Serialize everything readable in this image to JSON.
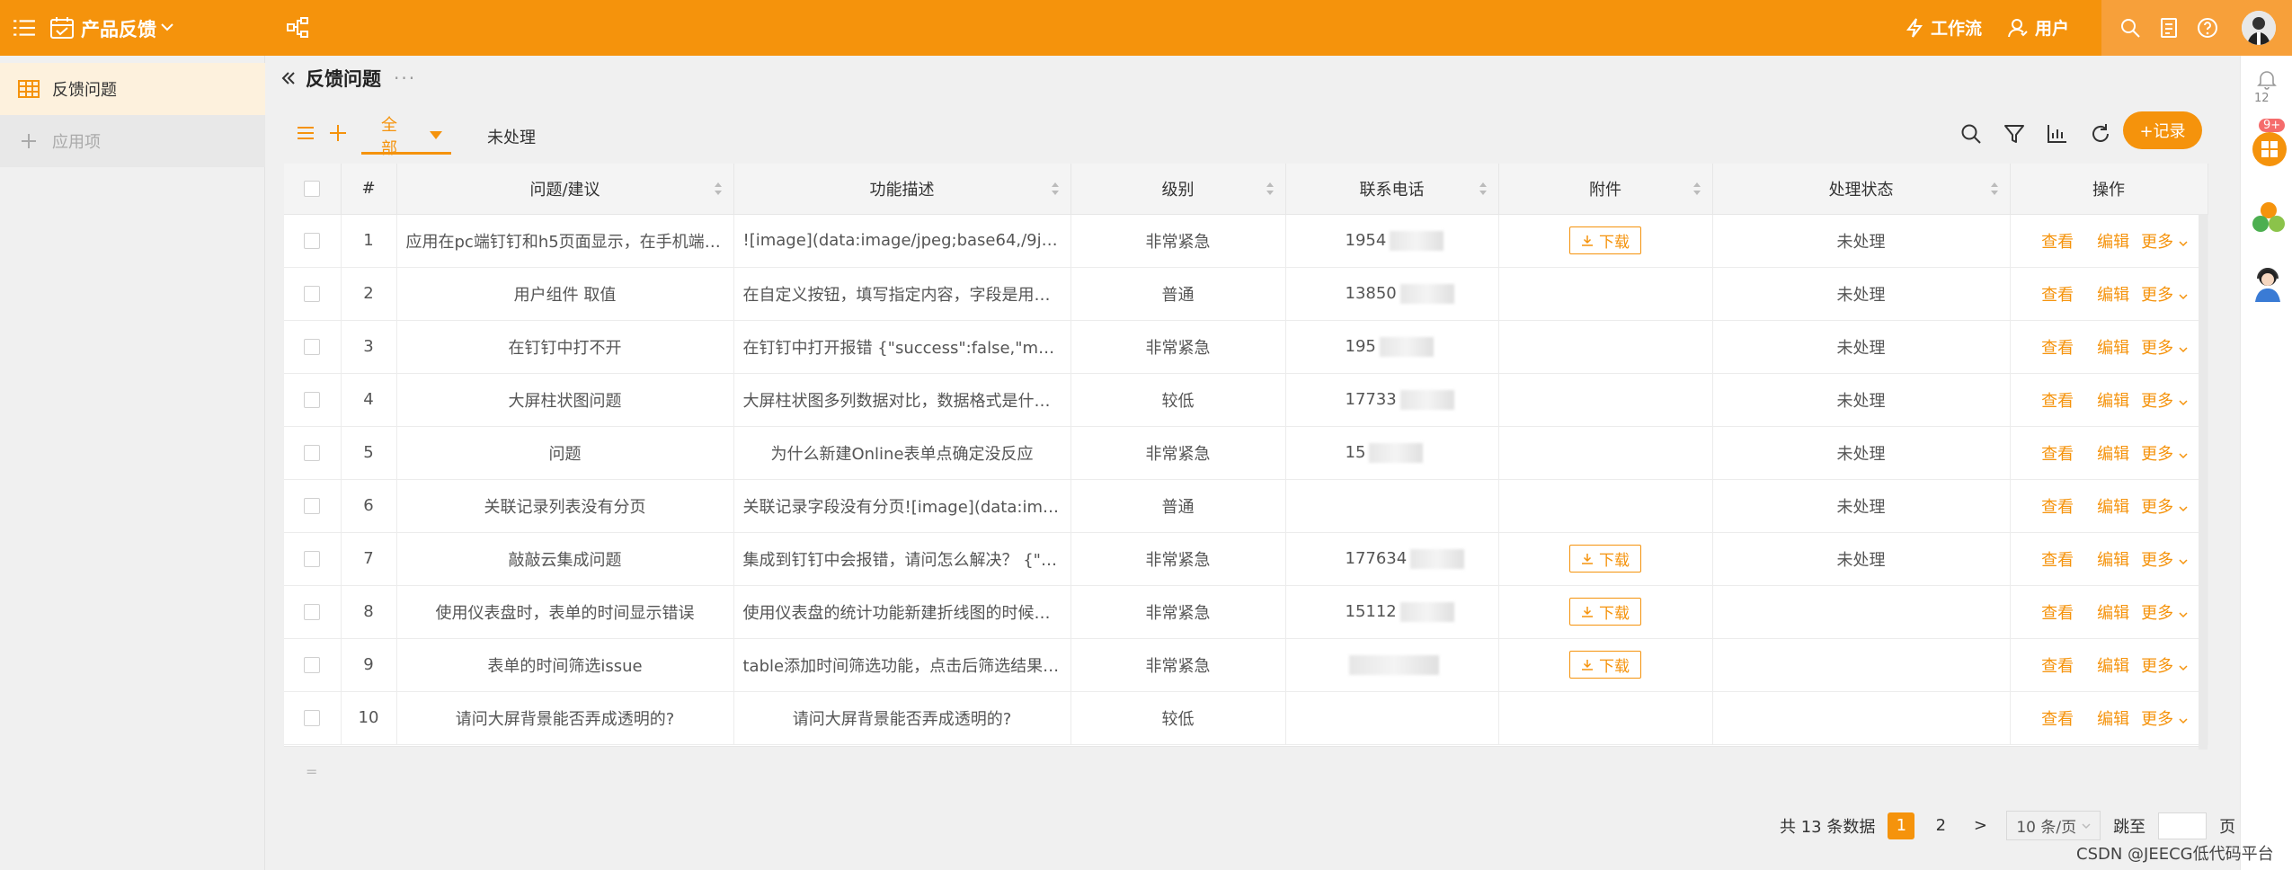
{
  "topbar": {
    "app_title": "产品反馈",
    "link_workflow": "工作流",
    "link_user": "用户"
  },
  "sidebar": {
    "items": [
      {
        "label": "反馈问题"
      },
      {
        "label": "应用项"
      }
    ]
  },
  "page": {
    "title": "反馈问题",
    "more": "···"
  },
  "toolbar": {
    "tab_all": "全部",
    "tab_unprocessed": "未处理",
    "add_label": "+记录"
  },
  "table": {
    "columns": [
      "#",
      "问题/建议",
      "功能描述",
      "级别",
      "联系电话",
      "附件",
      "处理状态",
      "操作"
    ],
    "rows": [
      {
        "no": "1",
        "issue": "应用在pc端钉钉和h5页面显示，在手机端钉...",
        "desc": "![image](data:image/jpeg;base64,/9j/4AAQS...",
        "level": "非常紧急",
        "phone": "1954",
        "attach": "下载",
        "status": "未处理"
      },
      {
        "no": "2",
        "issue": "用户组件 取值",
        "desc": "在自定义按钮，填写指定内容，字段是用户...",
        "level": "普通",
        "phone": "13850",
        "attach": "",
        "status": "未处理"
      },
      {
        "no": "3",
        "issue": "在钉钉中打不开",
        "desc": "在钉钉中打开报错 {\"success\":false,\"message...",
        "level": "非常紧急",
        "phone": "195",
        "attach": "",
        "status": "未处理"
      },
      {
        "no": "4",
        "issue": "大屏柱状图问题",
        "desc": "大屏柱状图多列数据对比，数据格式是什么...",
        "level": "较低",
        "phone": "17733",
        "attach": "",
        "status": "未处理"
      },
      {
        "no": "5",
        "issue": "问题",
        "desc": "为什么新建Online表单点确定没反应",
        "level": "非常紧急",
        "phone": "15",
        "attach": "",
        "status": "未处理"
      },
      {
        "no": "6",
        "issue": "关联记录列表没有分页",
        "desc": "关联记录字段没有分页![image](data:image/...",
        "level": "普通",
        "phone": "",
        "attach": "",
        "status": "未处理"
      },
      {
        "no": "7",
        "issue": "敲敲云集成问题",
        "desc": "集成到钉钉中会报错，请问怎么解决？ {\"suc...",
        "level": "非常紧急",
        "phone": "177634",
        "attach": "下载",
        "status": "未处理"
      },
      {
        "no": "8",
        "issue": "使用仪表盘时，表单的时间显示错误",
        "desc": "使用仪表盘的统计功能新建折线图的时候，x...",
        "level": "非常紧急",
        "phone": "15112",
        "attach": "下载",
        "status": ""
      },
      {
        "no": "9",
        "issue": "表单的时间筛选issue",
        "desc": "table添加时间筛选功能，点击后筛选结果为...",
        "level": "非常紧急",
        "phone": "",
        "attach": "下载",
        "status": ""
      },
      {
        "no": "10",
        "issue": "请问大屏背景能否弄成透明的?",
        "desc": "请问大屏背景能否弄成透明的?",
        "level": "较低",
        "phone": "",
        "attach": "",
        "status": ""
      }
    ],
    "actions": {
      "view": "查看",
      "edit": "编辑",
      "more": "更多"
    }
  },
  "pager": {
    "total": "共 13 条数据",
    "page1": "1",
    "page2": "2",
    "next": ">",
    "page_size": "10 条/页",
    "jump": "跳至",
    "page_unit": "页"
  },
  "rail": {
    "bell_count": "12",
    "app_badge": "9+"
  },
  "watermark": "CSDN @JEECG低代码平台",
  "colors": {
    "accent": "#f5930c",
    "topbar": "#f5930c"
  }
}
